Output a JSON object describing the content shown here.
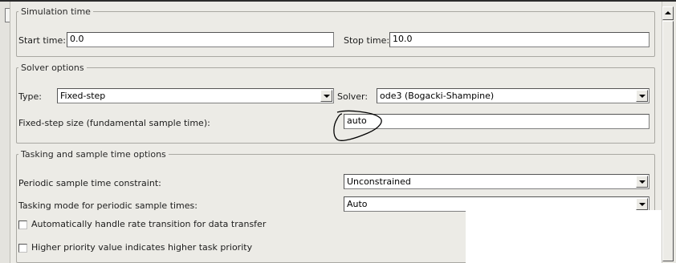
{
  "simulation_time": {
    "legend": "Simulation time",
    "start_label": "Start time:",
    "start_value": "0.0",
    "stop_label": "Stop time:",
    "stop_value": "10.0"
  },
  "solver_options": {
    "legend": "Solver options",
    "type_label": "Type:",
    "type_value": "Fixed-step",
    "solver_label": "Solver:",
    "solver_value": "ode3 (Bogacki-Shampine)",
    "step_size_label": "Fixed-step size (fundamental sample time):",
    "step_size_value": "auto"
  },
  "tasking": {
    "legend": "Tasking and sample time options",
    "periodic_constraint_label": "Periodic sample time constraint:",
    "periodic_constraint_value": "Unconstrained",
    "tasking_mode_label": "Tasking mode for periodic sample times:",
    "tasking_mode_value": "Auto",
    "checkbox_rate_transition": {
      "label": "Automatically handle rate transition for data transfer",
      "checked": false
    },
    "checkbox_priority": {
      "label": "Higher priority value indicates higher task priority",
      "checked": false
    }
  },
  "annotation": {
    "stroke_color": "#000000"
  }
}
